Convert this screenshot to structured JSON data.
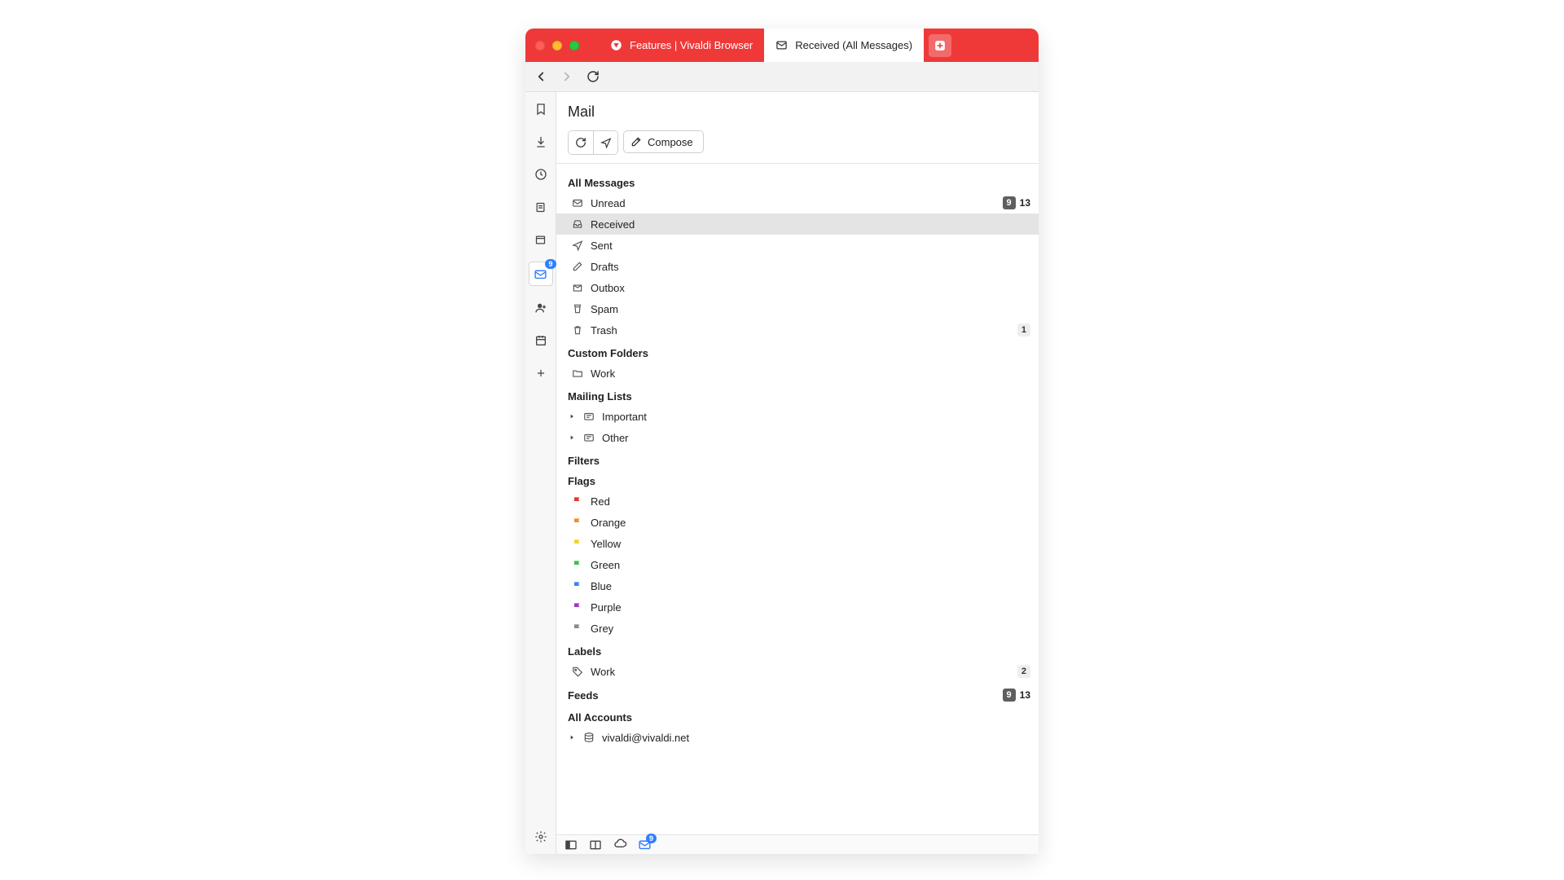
{
  "tabs": {
    "inactive_label": "Features | Vivaldi Browser",
    "active_label": "Received (All Messages)"
  },
  "sidebar_badge": "9",
  "panel": {
    "title": "Mail",
    "compose_label": "Compose"
  },
  "sections": {
    "all_messages": {
      "title": "All Messages",
      "items": [
        {
          "label": "Unread",
          "badge_dark": "9",
          "count": "13"
        },
        {
          "label": "Received"
        },
        {
          "label": "Sent"
        },
        {
          "label": "Drafts"
        },
        {
          "label": "Outbox"
        },
        {
          "label": "Spam"
        },
        {
          "label": "Trash",
          "badge_light": "1"
        }
      ]
    },
    "custom_folders": {
      "title": "Custom Folders",
      "items": [
        {
          "label": "Work"
        }
      ]
    },
    "mailing_lists": {
      "title": "Mailing Lists",
      "items": [
        {
          "label": "Important"
        },
        {
          "label": "Other"
        }
      ]
    },
    "filters": {
      "title": "Filters"
    },
    "flags": {
      "title": "Flags",
      "items": [
        {
          "label": "Red",
          "color": "#e63535"
        },
        {
          "label": "Orange",
          "color": "#f08c2a"
        },
        {
          "label": "Yellow",
          "color": "#f2d22e"
        },
        {
          "label": "Green",
          "color": "#3fbf4a"
        },
        {
          "label": "Blue",
          "color": "#3a82f0"
        },
        {
          "label": "Purple",
          "color": "#9c3abf"
        },
        {
          "label": "Grey",
          "color": "#8a8a8a"
        }
      ]
    },
    "labels": {
      "title": "Labels",
      "items": [
        {
          "label": "Work",
          "badge_light": "2"
        }
      ]
    },
    "feeds": {
      "title": "Feeds",
      "badge_dark": "9",
      "count": "13"
    },
    "accounts": {
      "title": "All Accounts",
      "items": [
        {
          "label": "vivaldi@vivaldi.net"
        }
      ]
    }
  },
  "statusbar_badge": "9"
}
